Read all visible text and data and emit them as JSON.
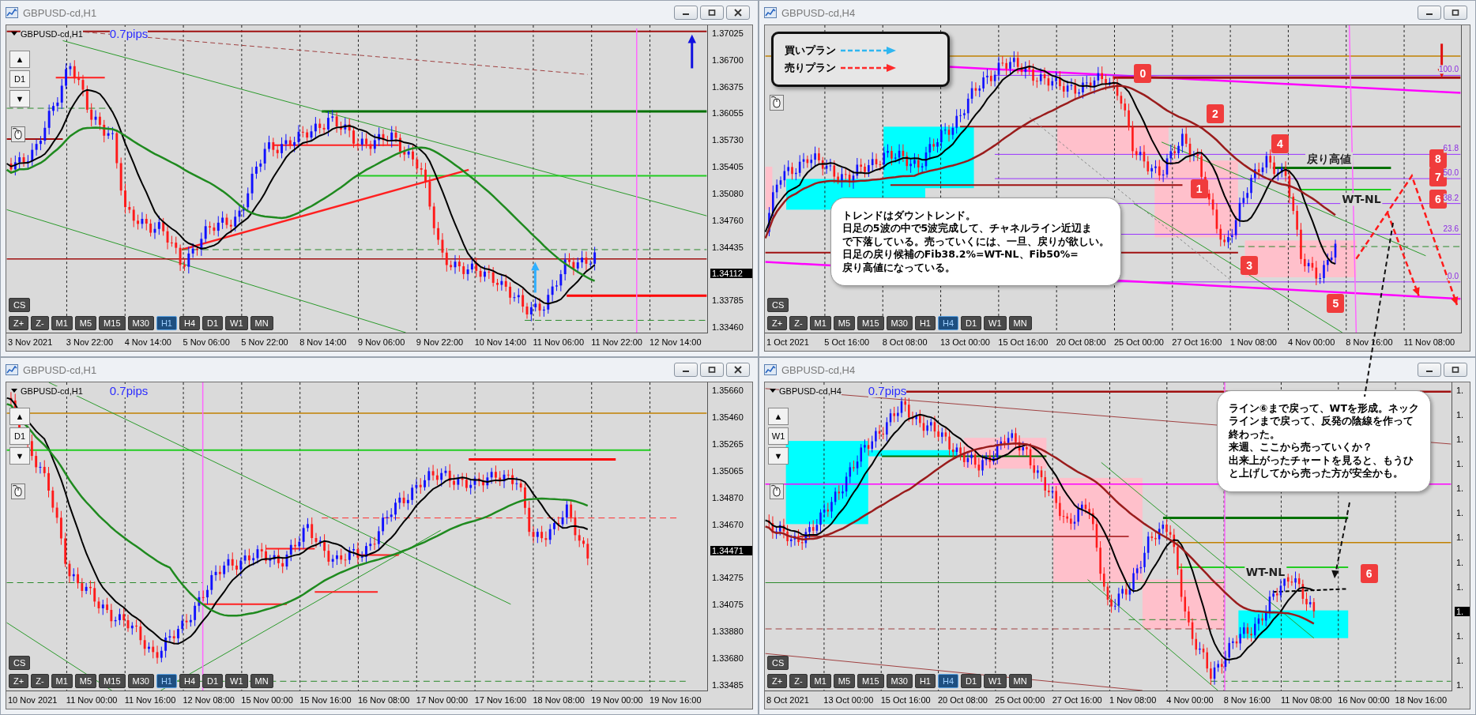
{
  "windows": [
    {
      "title": "GBPUSD-cd,H1",
      "window_controls": [
        {
          "kind": "minimize"
        },
        {
          "kind": "restore"
        },
        {
          "kind": "close"
        }
      ],
      "symbol": "GBPUSD-cd,H1",
      "spread": "0.7pips",
      "side_controls": {
        "up": "▲",
        "period": "D1",
        "down": "▼"
      },
      "price_labels": [
        {
          "text": "1.37025",
          "current": false
        },
        {
          "text": "1.36700",
          "current": false
        },
        {
          "text": "1.36375",
          "current": false
        },
        {
          "text": "1.36055",
          "current": false
        },
        {
          "text": "1.35730",
          "current": false
        },
        {
          "text": "1.35405",
          "current": false
        },
        {
          "text": "1.35080",
          "current": false
        },
        {
          "text": "1.34760",
          "current": false
        },
        {
          "text": "1.34435",
          "current": false
        },
        {
          "text": "1.34112",
          "current": true
        },
        {
          "text": "1.33785",
          "current": false
        },
        {
          "text": "1.33460",
          "current": false
        }
      ],
      "time_labels": [
        "3 Nov 2021",
        "3 Nov 22:00",
        "4 Nov 14:00",
        "5 Nov 06:00",
        "5 Nov 22:00",
        "8 Nov 14:00",
        "9 Nov 06:00",
        "9 Nov 22:00",
        "10 Nov 14:00",
        "11 Nov 06:00",
        "11 Nov 22:00",
        "12 Nov 14:00"
      ],
      "cs": "CS",
      "timeframes": [
        {
          "label": "Z+",
          "selected": false
        },
        {
          "label": "Z-",
          "selected": false
        },
        {
          "label": "M1",
          "selected": false
        },
        {
          "label": "M5",
          "selected": false
        },
        {
          "label": "M15",
          "selected": false
        },
        {
          "label": "M30",
          "selected": false
        },
        {
          "label": "H1",
          "selected": true
        },
        {
          "label": "H4",
          "selected": false
        },
        {
          "label": "D1",
          "selected": false
        },
        {
          "label": "W1",
          "selected": false
        },
        {
          "label": "MN",
          "selected": false
        }
      ]
    },
    {
      "title": "GBPUSD-cd,H4",
      "window_controls": [
        {
          "kind": "minimize"
        },
        {
          "kind": "restore"
        }
      ],
      "time_labels": [
        "1 Oct 2021",
        "5 Oct 16:00",
        "8 Oct 08:00",
        "13 Oct 00:00",
        "15 Oct 16:00",
        "20 Oct 08:00",
        "25 Oct 00:00",
        "27 Oct 16:00",
        "1 Nov 08:00",
        "4 Nov 00:00",
        "8 Nov 16:00",
        "11 Nov 08:00"
      ],
      "cs": "CS",
      "timeframes": [
        {
          "label": "Z+",
          "selected": false
        },
        {
          "label": "Z-",
          "selected": false
        },
        {
          "label": "M1",
          "selected": false
        },
        {
          "label": "M5",
          "selected": false
        },
        {
          "label": "M15",
          "selected": false
        },
        {
          "label": "M30",
          "selected": false
        },
        {
          "label": "H1",
          "selected": false
        },
        {
          "label": "H4",
          "selected": true
        },
        {
          "label": "D1",
          "selected": false
        },
        {
          "label": "W1",
          "selected": false
        },
        {
          "label": "MN",
          "selected": false
        }
      ],
      "legend": [
        {
          "label": "買いプラン",
          "kind": "buy"
        },
        {
          "label": "売りプラン",
          "kind": "sell"
        }
      ],
      "wave_labels": [
        "0",
        "2",
        "4",
        "1",
        "3",
        "5",
        "8",
        "7",
        "6"
      ],
      "fib_levels": [
        "100.0",
        "61.8",
        "50.0",
        "38.2",
        "23.6",
        "0.0"
      ],
      "level_labels": [
        "戻り高値",
        "WT-NL"
      ],
      "note": [
        "トレンドはダウントレンド。",
        "日足の5波の中で5波完成して、チャネルライン近辺ま",
        "で下落している。売っていくには、一旦、戻りが欲しい。",
        "日足の戻り候補のFib38.2%=WT-NL、Fib50%=",
        "戻り高値になっている。"
      ]
    },
    {
      "title": "GBPUSD-cd,H1",
      "window_controls": [
        {
          "kind": "minimize"
        },
        {
          "kind": "restore"
        },
        {
          "kind": "close"
        }
      ],
      "symbol": "GBPUSD-cd,H1",
      "spread": "0.7pips",
      "side_controls": {
        "up": "▲",
        "period": "D1",
        "down": "▼"
      },
      "price_labels": [
        {
          "text": "1.35660",
          "current": false
        },
        {
          "text": "1.35460",
          "current": false
        },
        {
          "text": "1.35265",
          "current": false
        },
        {
          "text": "1.35065",
          "current": false
        },
        {
          "text": "1.34870",
          "current": false
        },
        {
          "text": "1.34670",
          "current": false
        },
        {
          "text": "1.34471",
          "current": true
        },
        {
          "text": "1.34275",
          "current": false
        },
        {
          "text": "1.34075",
          "current": false
        },
        {
          "text": "1.33880",
          "current": false
        },
        {
          "text": "1.33680",
          "current": false
        },
        {
          "text": "1.33485",
          "current": false
        }
      ],
      "time_labels": [
        "10 Nov 2021",
        "11 Nov 00:00",
        "11 Nov 16:00",
        "12 Nov 08:00",
        "15 Nov 00:00",
        "15 Nov 16:00",
        "16 Nov 08:00",
        "17 Nov 00:00",
        "17 Nov 16:00",
        "18 Nov 08:00",
        "19 Nov 00:00",
        "19 Nov 16:00"
      ],
      "cs": "CS",
      "timeframes": [
        {
          "label": "Z+",
          "selected": false
        },
        {
          "label": "Z-",
          "selected": false
        },
        {
          "label": "M1",
          "selected": false
        },
        {
          "label": "M5",
          "selected": false
        },
        {
          "label": "M15",
          "selected": false
        },
        {
          "label": "M30",
          "selected": false
        },
        {
          "label": "H1",
          "selected": true
        },
        {
          "label": "H4",
          "selected": false
        },
        {
          "label": "D1",
          "selected": false
        },
        {
          "label": "W1",
          "selected": false
        },
        {
          "label": "MN",
          "selected": false
        }
      ]
    },
    {
      "title": "GBPUSD-cd,H4",
      "window_controls": [
        {
          "kind": "minimize"
        },
        {
          "kind": "restore"
        }
      ],
      "symbol": "GBPUSD-cd,H4",
      "spread": "0.7pips",
      "side_controls": {
        "up": "▲",
        "period": "W1",
        "down": "▼"
      },
      "price_labels": [
        {
          "text": "1.",
          "current": false
        },
        {
          "text": "1.",
          "current": false
        },
        {
          "text": "1.",
          "current": false
        },
        {
          "text": "1.",
          "current": false
        },
        {
          "text": "1.",
          "current": false
        },
        {
          "text": "1.",
          "current": false
        },
        {
          "text": "1.",
          "current": false
        },
        {
          "text": "1.",
          "current": false
        },
        {
          "text": "1.",
          "current": false
        },
        {
          "text": "1.",
          "current": true
        },
        {
          "text": "1.",
          "current": false
        },
        {
          "text": "1.",
          "current": false
        },
        {
          "text": "1.",
          "current": false
        }
      ],
      "time_labels": [
        "8 Oct 2021",
        "13 Oct 00:00",
        "15 Oct 16:00",
        "20 Oct 08:00",
        "25 Oct 00:00",
        "27 Oct 16:00",
        "1 Nov 08:00",
        "4 Nov 00:00",
        "8 Nov 16:00",
        "11 Nov 08:00",
        "16 Nov 00:00",
        "18 Nov 16:00"
      ],
      "cs": "CS",
      "timeframes": [
        {
          "label": "Z+",
          "selected": false
        },
        {
          "label": "Z-",
          "selected": false
        },
        {
          "label": "M1",
          "selected": false
        },
        {
          "label": "M5",
          "selected": false
        },
        {
          "label": "M15",
          "selected": false
        },
        {
          "label": "M30",
          "selected": false
        },
        {
          "label": "H1",
          "selected": false
        },
        {
          "label": "H4",
          "selected": true
        },
        {
          "label": "D1",
          "selected": false
        },
        {
          "label": "W1",
          "selected": false
        },
        {
          "label": "MN",
          "selected": false
        }
      ],
      "wave_labels": [
        "6"
      ],
      "level_labels": [
        "WT-NL"
      ],
      "note": [
        "ライン⑥まで戻って、WTを形成。ネック",
        "ラインまで戻って、反発の陰線を作って",
        "終わった。",
        "来週、ここから売っていくか？",
        "出来上がったチャートを見ると、もうひ",
        "と上げしてから売った方が安全かも。"
      ]
    }
  ]
}
